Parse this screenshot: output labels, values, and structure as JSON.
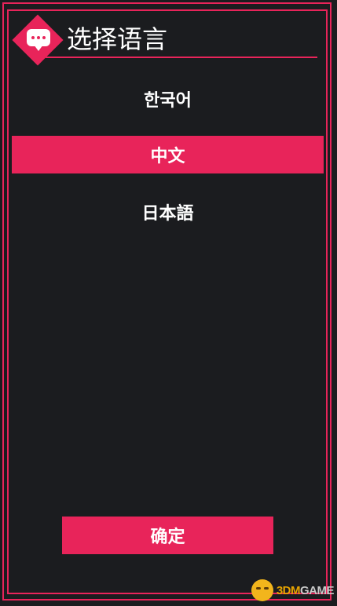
{
  "dialog": {
    "title": "选择语言",
    "confirm_label": "确定"
  },
  "languages": [
    {
      "label": "한국어",
      "selected": false
    },
    {
      "label": "中文",
      "selected": true
    },
    {
      "label": "日本語",
      "selected": false
    }
  ],
  "watermark": {
    "brand_accent": "3DM",
    "brand_rest": "GAME"
  },
  "colors": {
    "accent": "#e8245a",
    "background": "#1b1c1f",
    "text": "#ffffff"
  },
  "icons": {
    "header": "chat-bubble-icon"
  }
}
